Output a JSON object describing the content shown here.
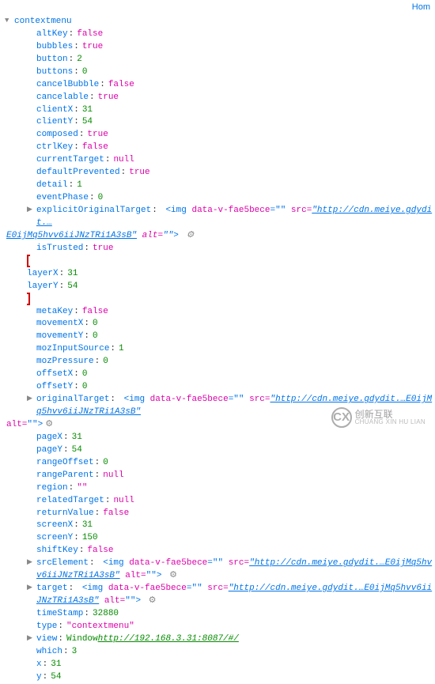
{
  "topbar": {
    "link": "Hom"
  },
  "root": {
    "label": "contextmenu"
  },
  "props": {
    "altKey": {
      "k": "altKey",
      "v": "false",
      "t": "bool"
    },
    "bubbles": {
      "k": "bubbles",
      "v": "true",
      "t": "bool"
    },
    "button": {
      "k": "button",
      "v": "2",
      "t": "num"
    },
    "buttons": {
      "k": "buttons",
      "v": "0",
      "t": "num"
    },
    "cancelBubble": {
      "k": "cancelBubble",
      "v": "false",
      "t": "bool"
    },
    "cancelable": {
      "k": "cancelable",
      "v": "true",
      "t": "bool"
    },
    "clientX": {
      "k": "clientX",
      "v": "31",
      "t": "num"
    },
    "clientY": {
      "k": "clientY",
      "v": "54",
      "t": "num"
    },
    "composed": {
      "k": "composed",
      "v": "true",
      "t": "bool"
    },
    "ctrlKey": {
      "k": "ctrlKey",
      "v": "false",
      "t": "bool"
    },
    "currentTarget": {
      "k": "currentTarget",
      "v": "null",
      "t": "null"
    },
    "defaultPrevented": {
      "k": "defaultPrevented",
      "v": "true",
      "t": "bool"
    },
    "detail": {
      "k": "detail",
      "v": "1",
      "t": "num"
    },
    "eventPhase": {
      "k": "eventPhase",
      "v": "0",
      "t": "num"
    },
    "isTrusted": {
      "k": "isTrusted",
      "v": "true",
      "t": "bool"
    },
    "layerX": {
      "k": "layerX",
      "v": "31",
      "t": "num"
    },
    "layerY": {
      "k": "layerY",
      "v": "54",
      "t": "num"
    },
    "metaKey": {
      "k": "metaKey",
      "v": "false",
      "t": "bool"
    },
    "movementX": {
      "k": "movementX",
      "v": "0",
      "t": "num"
    },
    "movementY": {
      "k": "movementY",
      "v": "0",
      "t": "num"
    },
    "mozInputSource": {
      "k": "mozInputSource",
      "v": "1",
      "t": "num"
    },
    "mozPressure": {
      "k": "mozPressure",
      "v": "0",
      "t": "num"
    },
    "offsetX": {
      "k": "offsetX",
      "v": "0",
      "t": "num"
    },
    "offsetY": {
      "k": "offsetY",
      "v": "0",
      "t": "num"
    },
    "pageX": {
      "k": "pageX",
      "v": "31",
      "t": "num"
    },
    "pageY": {
      "k": "pageY",
      "v": "54",
      "t": "num"
    },
    "rangeOffset": {
      "k": "rangeOffset",
      "v": "0",
      "t": "num"
    },
    "rangeParent": {
      "k": "rangeParent",
      "v": "null",
      "t": "null"
    },
    "region": {
      "k": "region",
      "v": "\"\"",
      "t": "str"
    },
    "relatedTarget": {
      "k": "relatedTarget",
      "v": "null",
      "t": "null"
    },
    "returnValue": {
      "k": "returnValue",
      "v": "false",
      "t": "bool"
    },
    "screenX": {
      "k": "screenX",
      "v": "31",
      "t": "num"
    },
    "screenY": {
      "k": "screenY",
      "v": "150",
      "t": "num"
    },
    "shiftKey": {
      "k": "shiftKey",
      "v": "false",
      "t": "bool"
    },
    "timeStamp": {
      "k": "timeStamp",
      "v": "32880",
      "t": "num"
    },
    "type": {
      "k": "type",
      "v": "\"contextmenu\"",
      "t": "str"
    },
    "which": {
      "k": "which",
      "v": "3",
      "t": "num"
    },
    "x": {
      "k": "x",
      "v": "31",
      "t": "num"
    },
    "y": {
      "k": "y",
      "v": "54",
      "t": "num"
    }
  },
  "explicit": {
    "k": "explicitOriginalTarget",
    "tagOpen": "<img",
    "attr1": "data-v-fae5bece",
    "attr1v": "=\"\"",
    "srclbl": "src=",
    "src": "\"http://cdn.meiye.gdydit.…",
    "cont": "E0ijMq5hvv6iiJNzTRi1A3sB\"",
    "altlbl": "alt=",
    "altv": "\"\"",
    "close": ">"
  },
  "origTarget": {
    "k": "originalTarget",
    "tagOpen": "<img",
    "attr1": "data-v-fae5bece",
    "attr1v": "=\"\"",
    "srclbl": "src=",
    "src": "\"http://cdn.meiye.gdydit.…E0ijMq5hvv6iiJNzTRi1A3sB\"",
    "altlbl": "alt=",
    "altv": "\"\"",
    "close": ">"
  },
  "srcElement": {
    "k": "srcElement",
    "tagOpen": "<img",
    "attr1": "data-v-fae5bece",
    "attr1v": "=\"\"",
    "srclbl": "src=",
    "src": "\"http://cdn.meiye.gdydit.…E0ijMq5hvv6iiJNzTRi1A3sB\"",
    "altlbl": "alt=",
    "altv": "\"\"",
    "close": ">"
  },
  "target": {
    "k": "target",
    "tagOpen": "<img",
    "attr1": "data-v-fae5bece",
    "attr1v": "=\"\"",
    "srclbl": "src=",
    "src": "\"http://cdn.meiye.gdydit.…E0ijMq5hvv6iiJNzTRi1A3sB\"",
    "altlbl": "alt=",
    "altv": "\"\"",
    "close": ">"
  },
  "view": {
    "k": "view",
    "obj": "Window ",
    "url": "http://192.168.3.31:8087/#/"
  },
  "watermark": {
    "logo": "CX",
    "cn": "创新互联",
    "en": "CHUANG XIN HU LIAN"
  }
}
